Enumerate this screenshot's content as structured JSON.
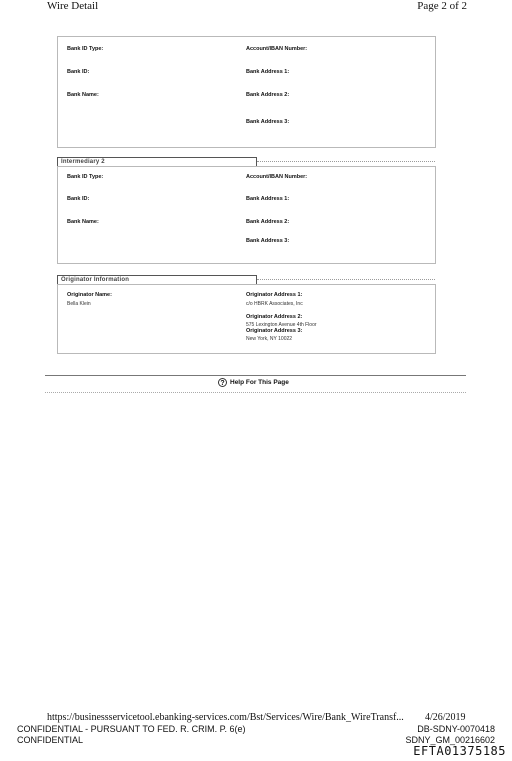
{
  "header": {
    "title": "Wire Detail",
    "page": "Page 2 of 2"
  },
  "beneficiary_bank": {
    "bank_id_type_label": "Bank ID Type:",
    "bank_id_label": "Bank ID:",
    "bank_name_label": "Bank Name:",
    "account_label": "Account/IBAN Number:",
    "address1_label": "Bank Address 1:",
    "address2_label": "Bank Address 2:",
    "address3_label": "Bank Address 3:"
  },
  "intermediary2": {
    "legend": "Intermediary 2",
    "bank_id_type_label": "Bank ID Type:",
    "bank_id_label": "Bank ID:",
    "bank_name_label": "Bank Name:",
    "account_label": "Account/IBAN Number:",
    "address1_label": "Bank Address 1:",
    "address2_label": "Bank Address 2:",
    "address3_label": "Bank Address 3:"
  },
  "originator": {
    "legend": "Originator Information",
    "name_label": "Originator Name:",
    "name_value": "Bella Klein",
    "address1_label": "Originator Address 1:",
    "address1_value": "c/o HBRK Associates, Inc",
    "address2_label": "Originator Address 2:",
    "address2_value": "575 Lexington Avenue 4th Floor",
    "address3_label": "Originator Address 3:",
    "address3_value": "New York, NY 10022"
  },
  "help": {
    "label": "Help For This Page",
    "icon": "help-circle-icon"
  },
  "footer": {
    "url": "https://businessservicetool.ebanking-services.com/Bst/Services/Wire/Bank_WireTransf...",
    "date": "4/26/2019",
    "confidential_line1": "CONFIDENTIAL - PURSUANT TO FED. R. CRIM. P. 6(e)",
    "confidential_line2": "CONFIDENTIAL",
    "bates1": "DB-SDNY-0070418",
    "bates2": "SDNY_GM_00216602",
    "efta": "EFTA01375185"
  }
}
